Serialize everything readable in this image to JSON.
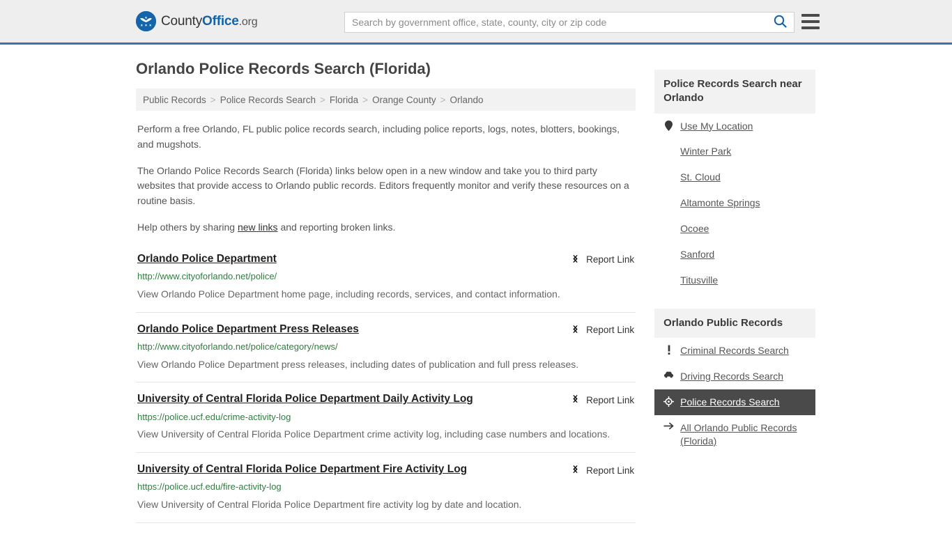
{
  "header": {
    "brand": {
      "part1": "County",
      "part2": "Office",
      "part3": ".org",
      "logo_icon": "eagle-stars-emblem"
    },
    "search": {
      "placeholder": "Search by government office, state, county, city or zip code",
      "value": "",
      "icon": "search-icon"
    },
    "menu_icon": "hamburger-menu-icon",
    "accent_color": "#3b73a8"
  },
  "main": {
    "title": "Orlando Police Records Search (Florida)",
    "breadcrumb": [
      {
        "label": "Public Records"
      },
      {
        "label": "Police Records Search"
      },
      {
        "label": "Florida"
      },
      {
        "label": "Orange County"
      },
      {
        "label": "Orlando"
      }
    ],
    "breadcrumb_separator": ">",
    "intro": {
      "p1": "Perform a free Orlando, FL public police records search, including police reports, logs, notes, blotters, bookings, and mugshots.",
      "p2": "The Orlando Police Records Search (Florida) links below open in a new window and take you to third party websites that provide access to Orlando public records. Editors frequently monitor and verify these resources on a routine basis.",
      "p3_before": "Help others by sharing ",
      "p3_link": "new links",
      "p3_after": " and reporting broken links."
    },
    "report_label": "Report Link",
    "report_icon": "broken-link-icon",
    "results": [
      {
        "title": "Orlando Police Department",
        "url": "http://www.cityoforlando.net/police/",
        "description": "View Orlando Police Department home page, including records, services, and contact information."
      },
      {
        "title": "Orlando Police Department Press Releases",
        "url": "http://www.cityoforlando.net/police/category/news/",
        "description": "View Orlando Police Department press releases, including dates of publication and full press releases."
      },
      {
        "title": "University of Central Florida Police Department Daily Activity Log",
        "url": "https://police.ucf.edu/crime-activity-log",
        "description": "View University of Central Florida Police Department crime activity log, including case numbers and locations."
      },
      {
        "title": "University of Central Florida Police Department Fire Activity Log",
        "url": "https://police.ucf.edu/fire-activity-log",
        "description": "View University of Central Florida Police Department fire activity log by date and location."
      }
    ]
  },
  "sidebar": {
    "nearby": {
      "heading": "Police Records Search near Orlando",
      "items": [
        {
          "label": "Use My Location",
          "icon": "map-pin-icon"
        },
        {
          "label": "Winter Park",
          "icon": ""
        },
        {
          "label": "St. Cloud",
          "icon": ""
        },
        {
          "label": "Altamonte Springs",
          "icon": ""
        },
        {
          "label": "Ocoee",
          "icon": ""
        },
        {
          "label": "Sanford",
          "icon": ""
        },
        {
          "label": "Titusville",
          "icon": ""
        }
      ]
    },
    "public_records": {
      "heading": "Orlando Public Records",
      "items": [
        {
          "label": "Criminal Records Search",
          "icon": "exclamation-icon",
          "active": false
        },
        {
          "label": "Driving Records Search",
          "icon": "car-icon",
          "active": false
        },
        {
          "label": "Police Records Search",
          "icon": "badge-target-icon",
          "active": true
        },
        {
          "label": "All Orlando Public Records (Florida)",
          "icon": "arrow-right-icon",
          "active": false
        }
      ]
    },
    "active_bg": "#4a4a4a"
  }
}
